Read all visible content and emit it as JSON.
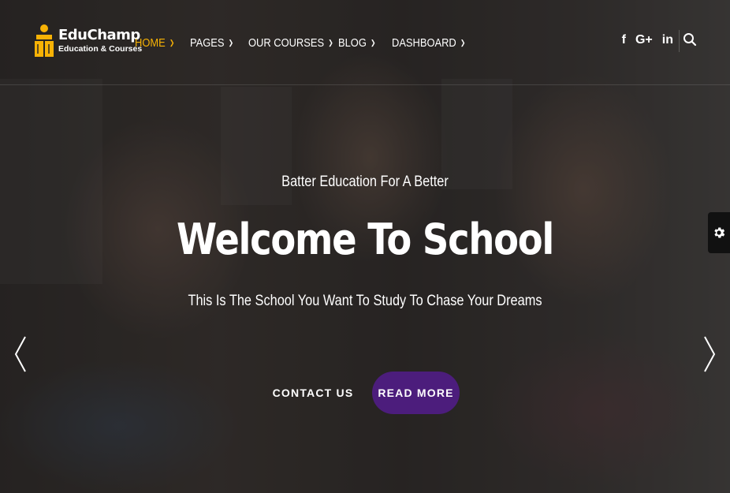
{
  "brand": {
    "name": "EduChamp",
    "tagline": "Education & Courses",
    "accent_color": "#f7b205"
  },
  "nav": {
    "items": [
      {
        "label": "HOME",
        "active": true
      },
      {
        "label": "PAGES"
      },
      {
        "label": "OUR COURSES"
      },
      {
        "label": "BLOG"
      },
      {
        "label": "DASHBOARD"
      }
    ]
  },
  "social": {
    "facebook": "f",
    "google_plus": "G+",
    "linkedin": "in"
  },
  "hero": {
    "kicker": "Batter Education For A Better",
    "title": "Welcome To School",
    "subtitle": "This Is The School You Want To Study To Chase Your Dreams",
    "contact_label": "CONTACT US",
    "read_more_label": "READ MORE",
    "button_color": "#4c1d7c"
  },
  "icons": {
    "search": "search-icon",
    "settings": "gear-icon",
    "prev": "chevron-left-icon",
    "next": "chevron-right-icon",
    "dropdown": "chevron-down-icon"
  }
}
